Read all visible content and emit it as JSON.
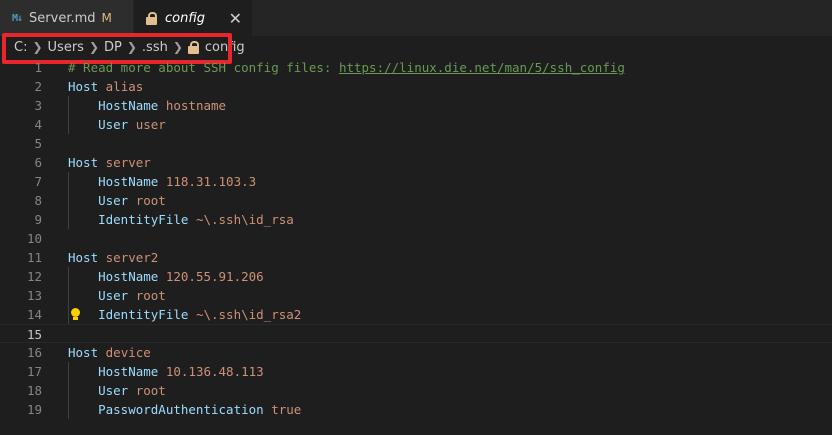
{
  "tabs": [
    {
      "icon": "M↓",
      "name": "Server.md",
      "modified": "M"
    },
    {
      "name": "config",
      "close": "✕"
    }
  ],
  "breadcrumb": [
    "C:",
    "Users",
    "DP",
    ".ssh",
    "config"
  ],
  "editor": {
    "lines": [
      {
        "n": "1",
        "tokens": [
          {
            "t": "# Read more about SSH config files: ",
            "c": "comment"
          },
          {
            "t": "https://linux.die.net/man/5/ssh_config",
            "c": "link"
          }
        ]
      },
      {
        "n": "2",
        "tokens": [
          {
            "t": "Host ",
            "c": "kw"
          },
          {
            "t": "alias",
            "c": "val"
          }
        ]
      },
      {
        "n": "3",
        "tokens": [
          {
            "t": "    HostName ",
            "c": "kw"
          },
          {
            "t": "hostname",
            "c": "val"
          }
        ]
      },
      {
        "n": "4",
        "tokens": [
          {
            "t": "    User ",
            "c": "kw"
          },
          {
            "t": "user",
            "c": "val"
          }
        ]
      },
      {
        "n": "5",
        "tokens": []
      },
      {
        "n": "6",
        "tokens": [
          {
            "t": "Host ",
            "c": "kw"
          },
          {
            "t": "server",
            "c": "val"
          }
        ]
      },
      {
        "n": "7",
        "tokens": [
          {
            "t": "    HostName ",
            "c": "kw"
          },
          {
            "t": "118.31.103.3",
            "c": "val"
          }
        ]
      },
      {
        "n": "8",
        "tokens": [
          {
            "t": "    User ",
            "c": "kw"
          },
          {
            "t": "root",
            "c": "val"
          }
        ]
      },
      {
        "n": "9",
        "tokens": [
          {
            "t": "    IdentityFile ",
            "c": "kw"
          },
          {
            "t": "~\\.ssh\\id_rsa",
            "c": "val"
          }
        ]
      },
      {
        "n": "10",
        "tokens": []
      },
      {
        "n": "11",
        "tokens": [
          {
            "t": "Host ",
            "c": "kw"
          },
          {
            "t": "server2",
            "c": "val"
          }
        ]
      },
      {
        "n": "12",
        "tokens": [
          {
            "t": "    HostName ",
            "c": "kw"
          },
          {
            "t": "120.55.91.206",
            "c": "val"
          }
        ]
      },
      {
        "n": "13",
        "tokens": [
          {
            "t": "    User ",
            "c": "kw"
          },
          {
            "t": "root",
            "c": "val"
          }
        ]
      },
      {
        "n": "14",
        "tokens": [
          {
            "t": "    IdentityFile ",
            "c": "kw"
          },
          {
            "t": "~\\.ssh\\id_rsa2",
            "c": "val"
          }
        ]
      },
      {
        "n": "15",
        "tokens": []
      },
      {
        "n": "16",
        "tokens": [
          {
            "t": "Host ",
            "c": "kw"
          },
          {
            "t": "device",
            "c": "val"
          }
        ]
      },
      {
        "n": "17",
        "tokens": [
          {
            "t": "    HostName ",
            "c": "kw"
          },
          {
            "t": "10.136.48.113",
            "c": "val"
          }
        ]
      },
      {
        "n": "18",
        "tokens": [
          {
            "t": "    User ",
            "c": "kw"
          },
          {
            "t": "root",
            "c": "val"
          }
        ]
      },
      {
        "n": "19",
        "tokens": [
          {
            "t": "    PasswordAuthentication ",
            "c": "kw"
          },
          {
            "t": "true",
            "c": "val"
          }
        ]
      }
    ]
  }
}
